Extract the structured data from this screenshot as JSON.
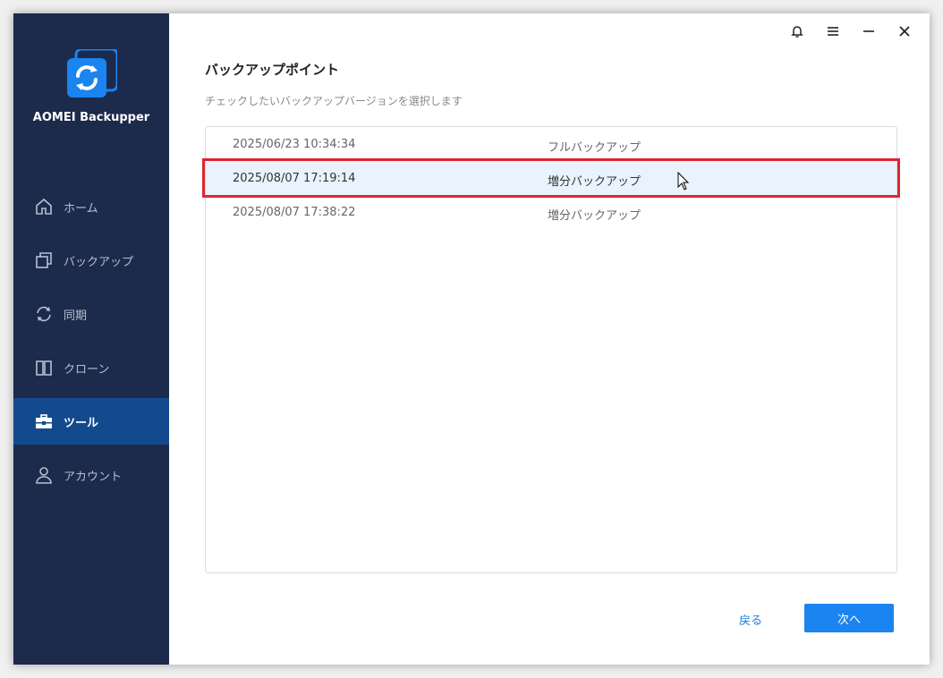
{
  "app": {
    "name": "AOMEI Backupper",
    "accent_color": "#1a84f0",
    "sidebar_color": "#1c2a4b",
    "logo_icon": "aomei-backupper-logo-icon"
  },
  "window_controls": [
    {
      "name": "notification-bell-icon"
    },
    {
      "name": "menu-icon"
    },
    {
      "name": "minimize-icon"
    },
    {
      "name": "close-icon"
    }
  ],
  "sidebar": {
    "items": [
      {
        "label": "ホーム",
        "icon": "home-icon",
        "active": false
      },
      {
        "label": "バックアップ",
        "icon": "backup-icon",
        "active": false
      },
      {
        "label": "同期",
        "icon": "sync-icon",
        "active": false
      },
      {
        "label": "クローン",
        "icon": "clone-icon",
        "active": false
      },
      {
        "label": "ツール",
        "icon": "toolbox-icon",
        "active": true
      },
      {
        "label": "アカウント",
        "icon": "user-icon",
        "active": false
      }
    ]
  },
  "main": {
    "title": "バックアップポイント",
    "subtitle": "チェックしたいバックアップバージョンを選択します",
    "backup_points": [
      {
        "date": "2025/06/23 10:34:34",
        "type": "フルバックアップ",
        "selected": false
      },
      {
        "date": "2025/08/07 17:19:14",
        "type": "増分バックアップ",
        "selected": true
      },
      {
        "date": "2025/08/07 17:38:22",
        "type": "増分バックアップ",
        "selected": false
      }
    ],
    "highlight_color": "#e0252e"
  },
  "footer": {
    "back_label": "戻る",
    "next_label": "次へ"
  }
}
